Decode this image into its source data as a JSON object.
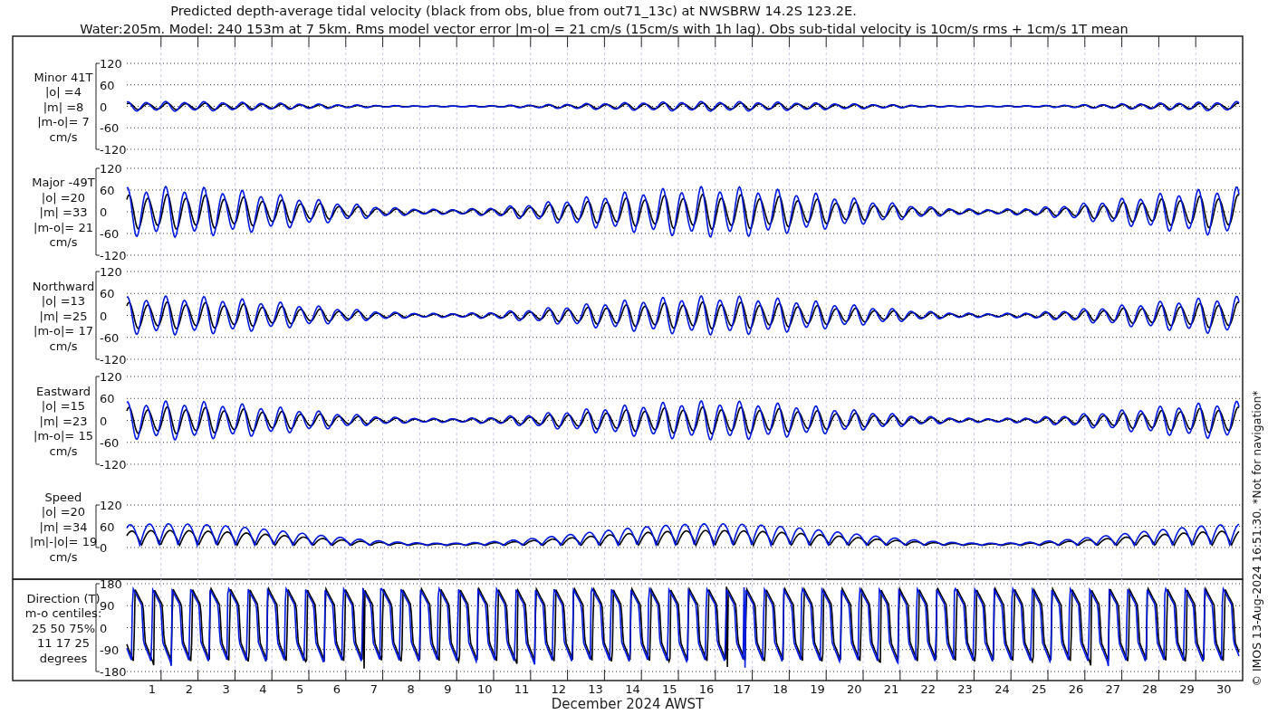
{
  "title_lines": [
    "Predicted depth-average tidal velocity (black from obs, blue from out71_13c) at NWSBRW 14.2S 123.2E.",
    "Water:205m. Model: 240 153m at 7 5km. Rms model vector error |m-o| = 21 cm/s (15cm/s with 1h lag). Obs sub-tidal velocity is 10cm/s rms + 1cm/s 1T mean"
  ],
  "panels": [
    {
      "kind": "velocity",
      "label_lines": [
        "Minor 41T",
        "|o| =4",
        "|m| =8",
        "|m-o|= 7",
        "cm/s"
      ],
      "yticks": [
        "120",
        "60",
        "0",
        "-60",
        "-120"
      ]
    },
    {
      "kind": "velocity",
      "label_lines": [
        "Major -49T",
        "|o| =20",
        "|m| =33",
        "|m-o|= 21",
        "cm/s"
      ],
      "yticks": [
        "120",
        "60",
        "0",
        "-60",
        "-120"
      ]
    },
    {
      "kind": "velocity",
      "label_lines": [
        "Northward",
        "|o| =13",
        "|m| =25",
        "|m-o|= 17",
        "cm/s"
      ],
      "yticks": [
        "120",
        "60",
        "0",
        "-60",
        "-120"
      ]
    },
    {
      "kind": "velocity",
      "label_lines": [
        "Eastward",
        "|o| =15",
        "|m| =23",
        "|m-o|= 15",
        "cm/s"
      ],
      "yticks": [
        "120",
        "60",
        "0",
        "-60",
        "-120"
      ]
    },
    {
      "kind": "speed",
      "label_lines": [
        "Speed",
        "|o| =20",
        "|m| =34",
        "|m|-|o|= 19",
        "cm/s"
      ],
      "yticks": [
        "120",
        "60",
        "0"
      ]
    },
    {
      "kind": "direction",
      "label_lines": [
        "Direction (T)",
        "m-o centiles:",
        "25  50  75%",
        "11  17  25",
        "degrees"
      ],
      "yticks": [
        "180",
        "90",
        "0",
        "-90",
        "-180"
      ]
    }
  ],
  "xaxis": {
    "day_labels": [
      "1",
      "2",
      "3",
      "4",
      "5",
      "6",
      "7",
      "8",
      "9",
      "10",
      "11",
      "12",
      "13",
      "14",
      "15",
      "16",
      "17",
      "18",
      "19",
      "20",
      "21",
      "22",
      "23",
      "24",
      "25",
      "26",
      "27",
      "28",
      "29",
      "30"
    ],
    "label": "December 2024 AWST"
  },
  "credit": "© IMOS 13-Aug-2024 16:51:30. *Not for navigation*"
}
